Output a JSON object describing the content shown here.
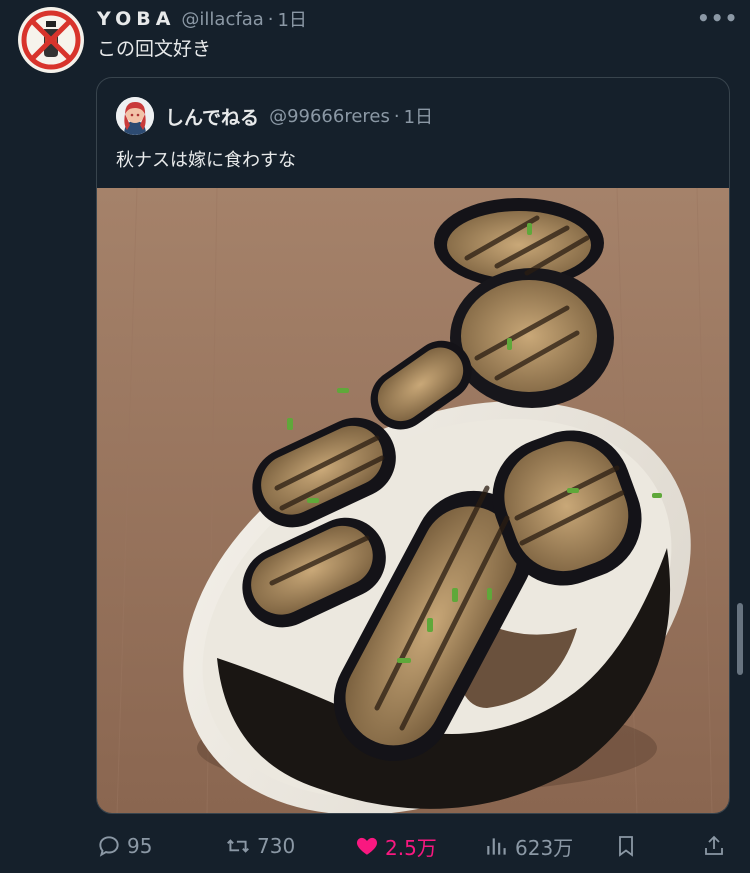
{
  "tweet": {
    "author_name": "YOBA",
    "author_handle": "@illacfaa",
    "separator": "·",
    "time": "1日",
    "text": "この回文好き",
    "more_icon": "more-horizontal-icon"
  },
  "quote": {
    "author_name": "しんでねる",
    "author_handle": "@99666reres",
    "separator": "·",
    "time": "1日",
    "text": "秋ナスは嫁に食わすな",
    "image_alt": "grilled eggplant on a plate"
  },
  "actions": {
    "replies": "95",
    "retweets": "730",
    "likes": "2.5万",
    "views": "623万",
    "like_color": "#f91880",
    "icons": [
      "reply-icon",
      "retweet-icon",
      "like-icon",
      "views-icon",
      "bookmark-icon",
      "share-icon"
    ]
  },
  "colors": {
    "background": "#15202b",
    "text": "#e7e9ea",
    "muted": "#8b98a5",
    "border": "#38444d"
  }
}
